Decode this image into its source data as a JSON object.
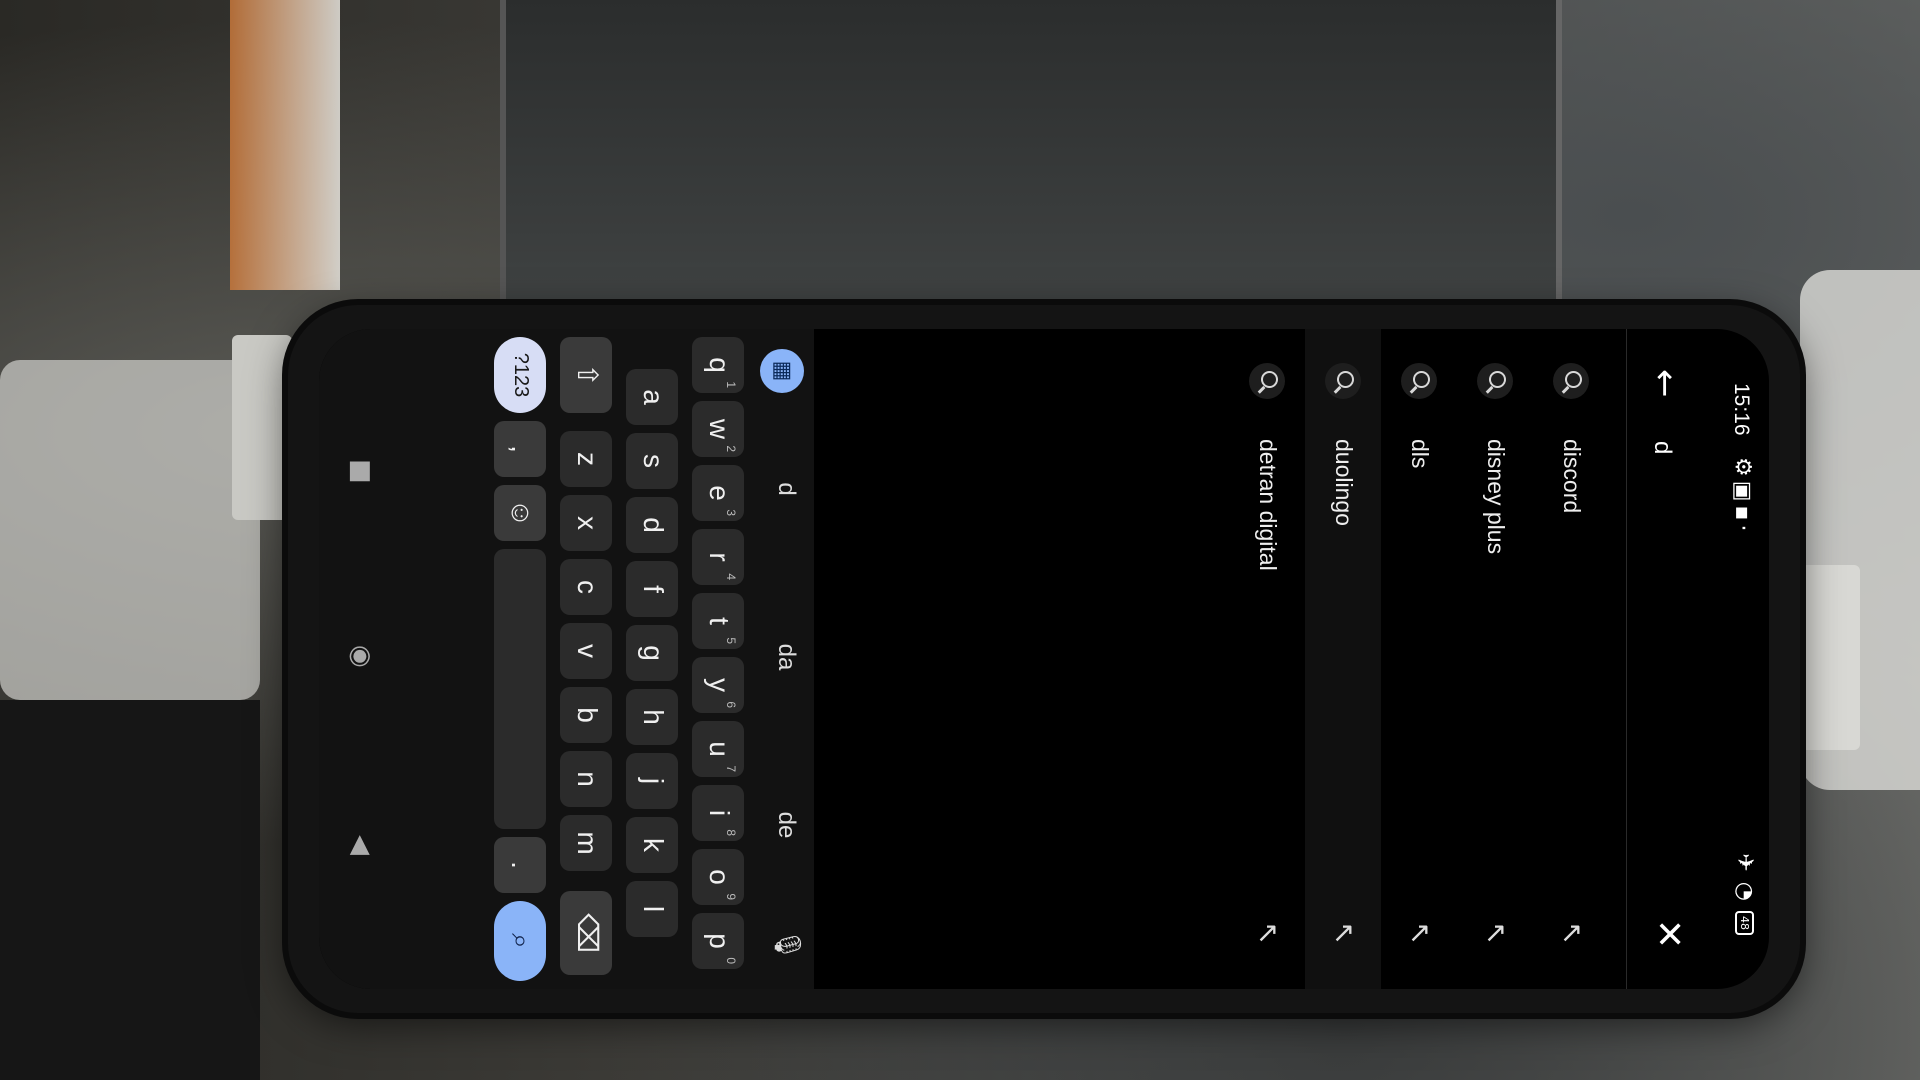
{
  "status": {
    "time": "15:16",
    "battery": "48",
    "icons_left": [
      "gear-icon",
      "notification-icon",
      "notification-icon",
      "dot-icon"
    ],
    "icons_right": [
      "airplane-icon",
      "wifi-icon",
      "battery-icon"
    ]
  },
  "search": {
    "query": "d"
  },
  "suggestions": [
    {
      "text": "discord"
    },
    {
      "text": "disney plus"
    },
    {
      "text": "dls"
    },
    {
      "text": "duolingo"
    },
    {
      "text": "detran digital"
    }
  ],
  "keyboard": {
    "suggestions": [
      "d",
      "da",
      "de"
    ],
    "row1": [
      {
        "key": "q",
        "hint": "1"
      },
      {
        "key": "w",
        "hint": "2"
      },
      {
        "key": "e",
        "hint": "3"
      },
      {
        "key": "r",
        "hint": "4"
      },
      {
        "key": "t",
        "hint": "5"
      },
      {
        "key": "y",
        "hint": "6"
      },
      {
        "key": "u",
        "hint": "7"
      },
      {
        "key": "i",
        "hint": "8"
      },
      {
        "key": "o",
        "hint": "9"
      },
      {
        "key": "p",
        "hint": "0"
      }
    ],
    "row2": [
      "a",
      "s",
      "d",
      "f",
      "g",
      "h",
      "j",
      "k",
      "l"
    ],
    "row3": [
      "z",
      "x",
      "c",
      "v",
      "b",
      "n",
      "m"
    ],
    "sym_label": "?123",
    "comma": ",",
    "period": "."
  },
  "colors": {
    "accent": "#8ab4f8",
    "screen_bg": "#000000",
    "key_bg": "#2b2b2b"
  }
}
